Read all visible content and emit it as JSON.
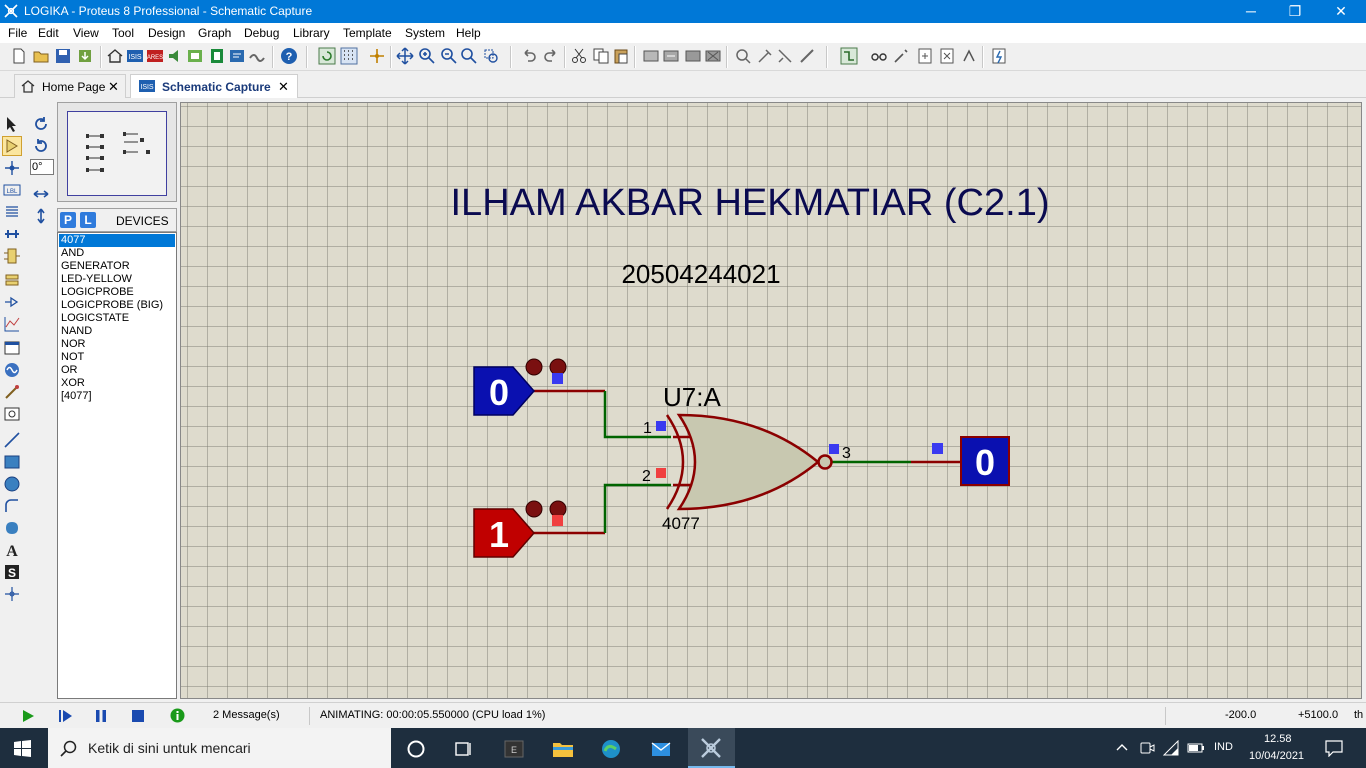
{
  "window": {
    "title": "LOGIKA - Proteus 8 Professional - Schematic Capture",
    "minimize": "─",
    "maximize": "❐",
    "close": "✕"
  },
  "menu": [
    "File",
    "Edit",
    "View",
    "Tool",
    "Design",
    "Graph",
    "Debug",
    "Library",
    "Template",
    "System",
    "Help"
  ],
  "tabs": [
    {
      "label": "Home Page",
      "close": "✕",
      "icon": "home-icon"
    },
    {
      "label": "Schematic Capture",
      "close": "✕",
      "icon": "schematic-icon"
    }
  ],
  "rotation": {
    "angle": "0°"
  },
  "devices": {
    "header": "DEVICES",
    "p_button": "P",
    "l_button": "L",
    "items": [
      "4077",
      "AND",
      "GENERATOR",
      "LED-YELLOW",
      "LOGICPROBE",
      "LOGICPROBE (BIG)",
      "LOGICSTATE",
      "NAND",
      "NOR",
      "NOT",
      "OR",
      "XOR",
      "[4077]"
    ],
    "selected": "4077"
  },
  "schematic": {
    "title": "ILHAM AKBAR HEKMATIAR (C2.1)",
    "id_number": "20504244021",
    "gate_ref": "U7:A",
    "gate_part": "4077",
    "pin1": "1",
    "pin2": "2",
    "pin3": "3",
    "input_a": "0",
    "input_b": "1",
    "output": "0",
    "colors": {
      "low": "#0a10b0",
      "high": "#c00000",
      "wire_low": "#006400",
      "wire_high": "#8b0000",
      "gate_fill": "#c8c8b0"
    }
  },
  "status": {
    "messages": "2 Message(s)",
    "animating": "ANIMATING: 00:00:05.550000 (CPU load 1%)",
    "coord_x": "-200.0",
    "coord_y": "+5100.0",
    "unit": "th"
  },
  "taskbar": {
    "search_placeholder": "Ketik di sini untuk mencari",
    "language": "IND",
    "time": "12.58",
    "date": "10/04/2021"
  }
}
